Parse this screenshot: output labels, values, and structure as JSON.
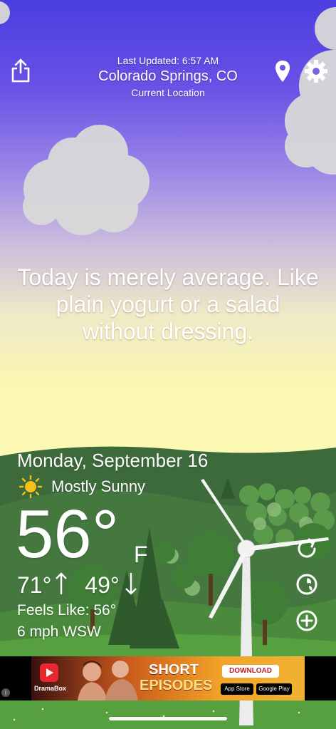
{
  "header": {
    "last_updated": "Last Updated: 6:57 AM",
    "city": "Colorado Springs, CO",
    "location_label": "Current Location"
  },
  "message": {
    "line1": "Today is merely average. Like",
    "line2": "plain yogurt or a salad",
    "line3": "without dressing."
  },
  "weather": {
    "date": "Monday, September 16",
    "condition": "Mostly Sunny",
    "temp": "56°",
    "unit": "F",
    "high": "71°",
    "low": "49°",
    "feels_like": "Feels Like: 56°",
    "wind": "6 mph WSW"
  },
  "ad": {
    "brand": "DramaBox",
    "headline_line1": "SHORT",
    "headline_line2": "EPISODES",
    "download_label": "DOWNLOAD",
    "app_store": "App Store",
    "google_play": "Google Play",
    "info_glyph": "i"
  },
  "icons": [
    "share-icon",
    "location-pin-icon",
    "gear-icon",
    "refresh-icon",
    "radar-icon",
    "add-location-icon",
    "sun-icon"
  ]
}
